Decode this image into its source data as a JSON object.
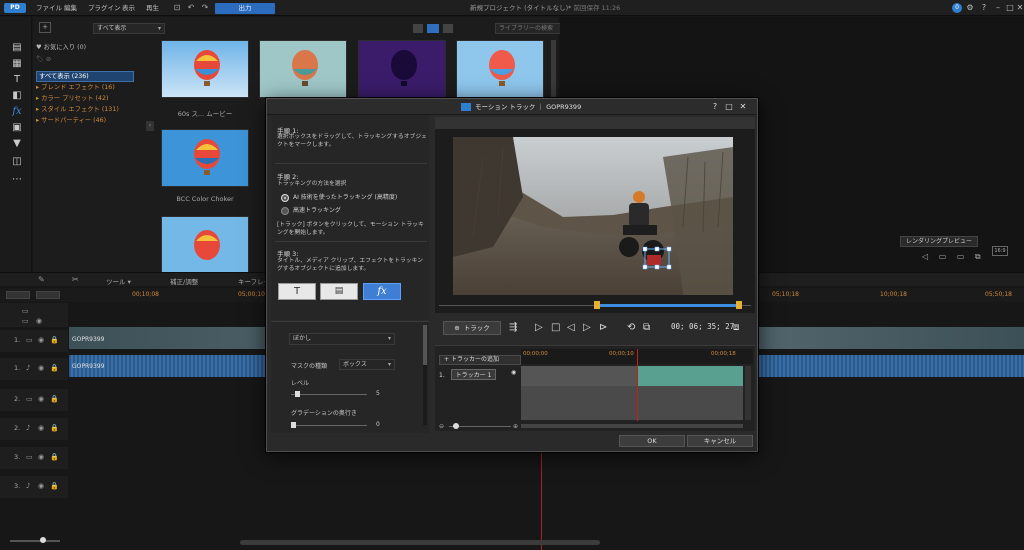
{
  "app": {
    "window_title": "新規プロジェクト (タイトルなし)*",
    "saved_status": "前回保存 11:26",
    "menu": [
      "ファイル",
      "編集",
      "プラグイン",
      "表示",
      "再生"
    ],
    "output_button": "出力",
    "notification_count": "0"
  },
  "library": {
    "view_dropdown": "すべて表示",
    "search_placeholder": "ライブラリーの検索",
    "tree": [
      {
        "label": "お気に入り (0)",
        "kind": "normal"
      },
      {
        "label": "すべて表示 (236)",
        "kind": "selected"
      },
      {
        "label": "ブレンド エフェクト (16)",
        "kind": "orange"
      },
      {
        "label": "カラー プリセット (42)",
        "kind": "orange"
      },
      {
        "label": "スタイル エフェクト (131)",
        "kind": "orange"
      },
      {
        "label": "サードパーティー (46)",
        "kind": "orange"
      }
    ],
    "thumbs": [
      {
        "caption": "60s ス... ムービー"
      },
      {
        "caption": "BCC Color Choker"
      }
    ]
  },
  "preview": {
    "render_preview": "レンダリングプレビュー"
  },
  "timeline": {
    "toolbar": [
      "ツール",
      "補正/調整",
      "キーフレーム"
    ],
    "ruler": [
      "00;10;08",
      "05;00;10",
      "10;00;18",
      "05;10;18",
      "10;00;18",
      "05;50;18"
    ],
    "tracks": [
      "1.",
      "1.",
      "2.",
      "2.",
      "3.",
      "3."
    ],
    "clip_label": "GOPR9399"
  },
  "modal": {
    "title": "モーション トラック ｜ GOPR9399",
    "step1_heading": "手順 1:",
    "step1_text": "選択ボックスをドラッグして、トラッキングするオブジェクトをマークします。",
    "step2_heading": "手順 2:",
    "step2_text": "トラッキングの方法を選択",
    "option_ai": "AI 技術を使ったトラッキング (高精度)",
    "option_fast": "高速トラッキング",
    "step2_note": "[トラック] ボタンをクリックして、モーション トラッキングを開始します。",
    "step3_heading": "手順 3:",
    "step3_text": "タイトル、メディア クリップ、エフェクトをトラッキングするオブジェクトに追加します。",
    "effect_dropdown": "ぼかし",
    "mask_type_label": "マスクの種類",
    "mask_type_value": "ボックス",
    "level_label": "レベル",
    "level_value": "5",
    "gradient_label": "グラデーションの奥行き",
    "gradient_value": "0",
    "track_button": "トラック",
    "timecode": "00; 06; 35; 27",
    "add_tracker": "トラッカーの追加",
    "tracker_name": "トラッカー 1",
    "tracker_index": "1.",
    "ruler": [
      "00;00;00",
      "00;00;10",
      "00;00;18"
    ],
    "ok": "OK",
    "cancel": "キャンセル",
    "help": "?",
    "fx_t": "T",
    "fx_fx": "fx"
  }
}
